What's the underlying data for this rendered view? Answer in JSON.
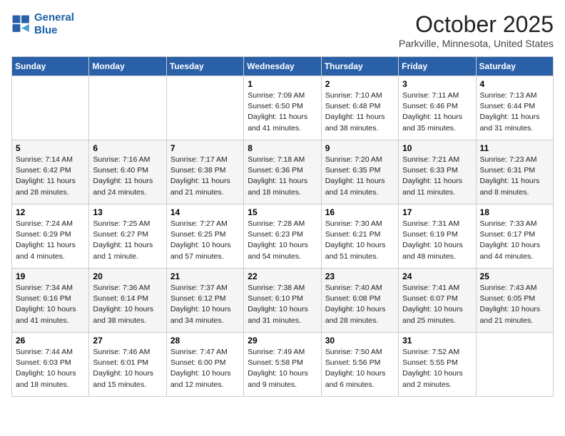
{
  "header": {
    "logo_line1": "General",
    "logo_line2": "Blue",
    "month_title": "October 2025",
    "location": "Parkville, Minnesota, United States"
  },
  "days_of_week": [
    "Sunday",
    "Monday",
    "Tuesday",
    "Wednesday",
    "Thursday",
    "Friday",
    "Saturday"
  ],
  "weeks": [
    [
      {
        "day": "",
        "info": ""
      },
      {
        "day": "",
        "info": ""
      },
      {
        "day": "",
        "info": ""
      },
      {
        "day": "1",
        "info": "Sunrise: 7:09 AM\nSunset: 6:50 PM\nDaylight: 11 hours and 41 minutes."
      },
      {
        "day": "2",
        "info": "Sunrise: 7:10 AM\nSunset: 6:48 PM\nDaylight: 11 hours and 38 minutes."
      },
      {
        "day": "3",
        "info": "Sunrise: 7:11 AM\nSunset: 6:46 PM\nDaylight: 11 hours and 35 minutes."
      },
      {
        "day": "4",
        "info": "Sunrise: 7:13 AM\nSunset: 6:44 PM\nDaylight: 11 hours and 31 minutes."
      }
    ],
    [
      {
        "day": "5",
        "info": "Sunrise: 7:14 AM\nSunset: 6:42 PM\nDaylight: 11 hours and 28 minutes."
      },
      {
        "day": "6",
        "info": "Sunrise: 7:16 AM\nSunset: 6:40 PM\nDaylight: 11 hours and 24 minutes."
      },
      {
        "day": "7",
        "info": "Sunrise: 7:17 AM\nSunset: 6:38 PM\nDaylight: 11 hours and 21 minutes."
      },
      {
        "day": "8",
        "info": "Sunrise: 7:18 AM\nSunset: 6:36 PM\nDaylight: 11 hours and 18 minutes."
      },
      {
        "day": "9",
        "info": "Sunrise: 7:20 AM\nSunset: 6:35 PM\nDaylight: 11 hours and 14 minutes."
      },
      {
        "day": "10",
        "info": "Sunrise: 7:21 AM\nSunset: 6:33 PM\nDaylight: 11 hours and 11 minutes."
      },
      {
        "day": "11",
        "info": "Sunrise: 7:23 AM\nSunset: 6:31 PM\nDaylight: 11 hours and 8 minutes."
      }
    ],
    [
      {
        "day": "12",
        "info": "Sunrise: 7:24 AM\nSunset: 6:29 PM\nDaylight: 11 hours and 4 minutes."
      },
      {
        "day": "13",
        "info": "Sunrise: 7:25 AM\nSunset: 6:27 PM\nDaylight: 11 hours and 1 minute."
      },
      {
        "day": "14",
        "info": "Sunrise: 7:27 AM\nSunset: 6:25 PM\nDaylight: 10 hours and 57 minutes."
      },
      {
        "day": "15",
        "info": "Sunrise: 7:28 AM\nSunset: 6:23 PM\nDaylight: 10 hours and 54 minutes."
      },
      {
        "day": "16",
        "info": "Sunrise: 7:30 AM\nSunset: 6:21 PM\nDaylight: 10 hours and 51 minutes."
      },
      {
        "day": "17",
        "info": "Sunrise: 7:31 AM\nSunset: 6:19 PM\nDaylight: 10 hours and 48 minutes."
      },
      {
        "day": "18",
        "info": "Sunrise: 7:33 AM\nSunset: 6:17 PM\nDaylight: 10 hours and 44 minutes."
      }
    ],
    [
      {
        "day": "19",
        "info": "Sunrise: 7:34 AM\nSunset: 6:16 PM\nDaylight: 10 hours and 41 minutes."
      },
      {
        "day": "20",
        "info": "Sunrise: 7:36 AM\nSunset: 6:14 PM\nDaylight: 10 hours and 38 minutes."
      },
      {
        "day": "21",
        "info": "Sunrise: 7:37 AM\nSunset: 6:12 PM\nDaylight: 10 hours and 34 minutes."
      },
      {
        "day": "22",
        "info": "Sunrise: 7:38 AM\nSunset: 6:10 PM\nDaylight: 10 hours and 31 minutes."
      },
      {
        "day": "23",
        "info": "Sunrise: 7:40 AM\nSunset: 6:08 PM\nDaylight: 10 hours and 28 minutes."
      },
      {
        "day": "24",
        "info": "Sunrise: 7:41 AM\nSunset: 6:07 PM\nDaylight: 10 hours and 25 minutes."
      },
      {
        "day": "25",
        "info": "Sunrise: 7:43 AM\nSunset: 6:05 PM\nDaylight: 10 hours and 21 minutes."
      }
    ],
    [
      {
        "day": "26",
        "info": "Sunrise: 7:44 AM\nSunset: 6:03 PM\nDaylight: 10 hours and 18 minutes."
      },
      {
        "day": "27",
        "info": "Sunrise: 7:46 AM\nSunset: 6:01 PM\nDaylight: 10 hours and 15 minutes."
      },
      {
        "day": "28",
        "info": "Sunrise: 7:47 AM\nSunset: 6:00 PM\nDaylight: 10 hours and 12 minutes."
      },
      {
        "day": "29",
        "info": "Sunrise: 7:49 AM\nSunset: 5:58 PM\nDaylight: 10 hours and 9 minutes."
      },
      {
        "day": "30",
        "info": "Sunrise: 7:50 AM\nSunset: 5:56 PM\nDaylight: 10 hours and 6 minutes."
      },
      {
        "day": "31",
        "info": "Sunrise: 7:52 AM\nSunset: 5:55 PM\nDaylight: 10 hours and 2 minutes."
      },
      {
        "day": "",
        "info": ""
      }
    ]
  ]
}
